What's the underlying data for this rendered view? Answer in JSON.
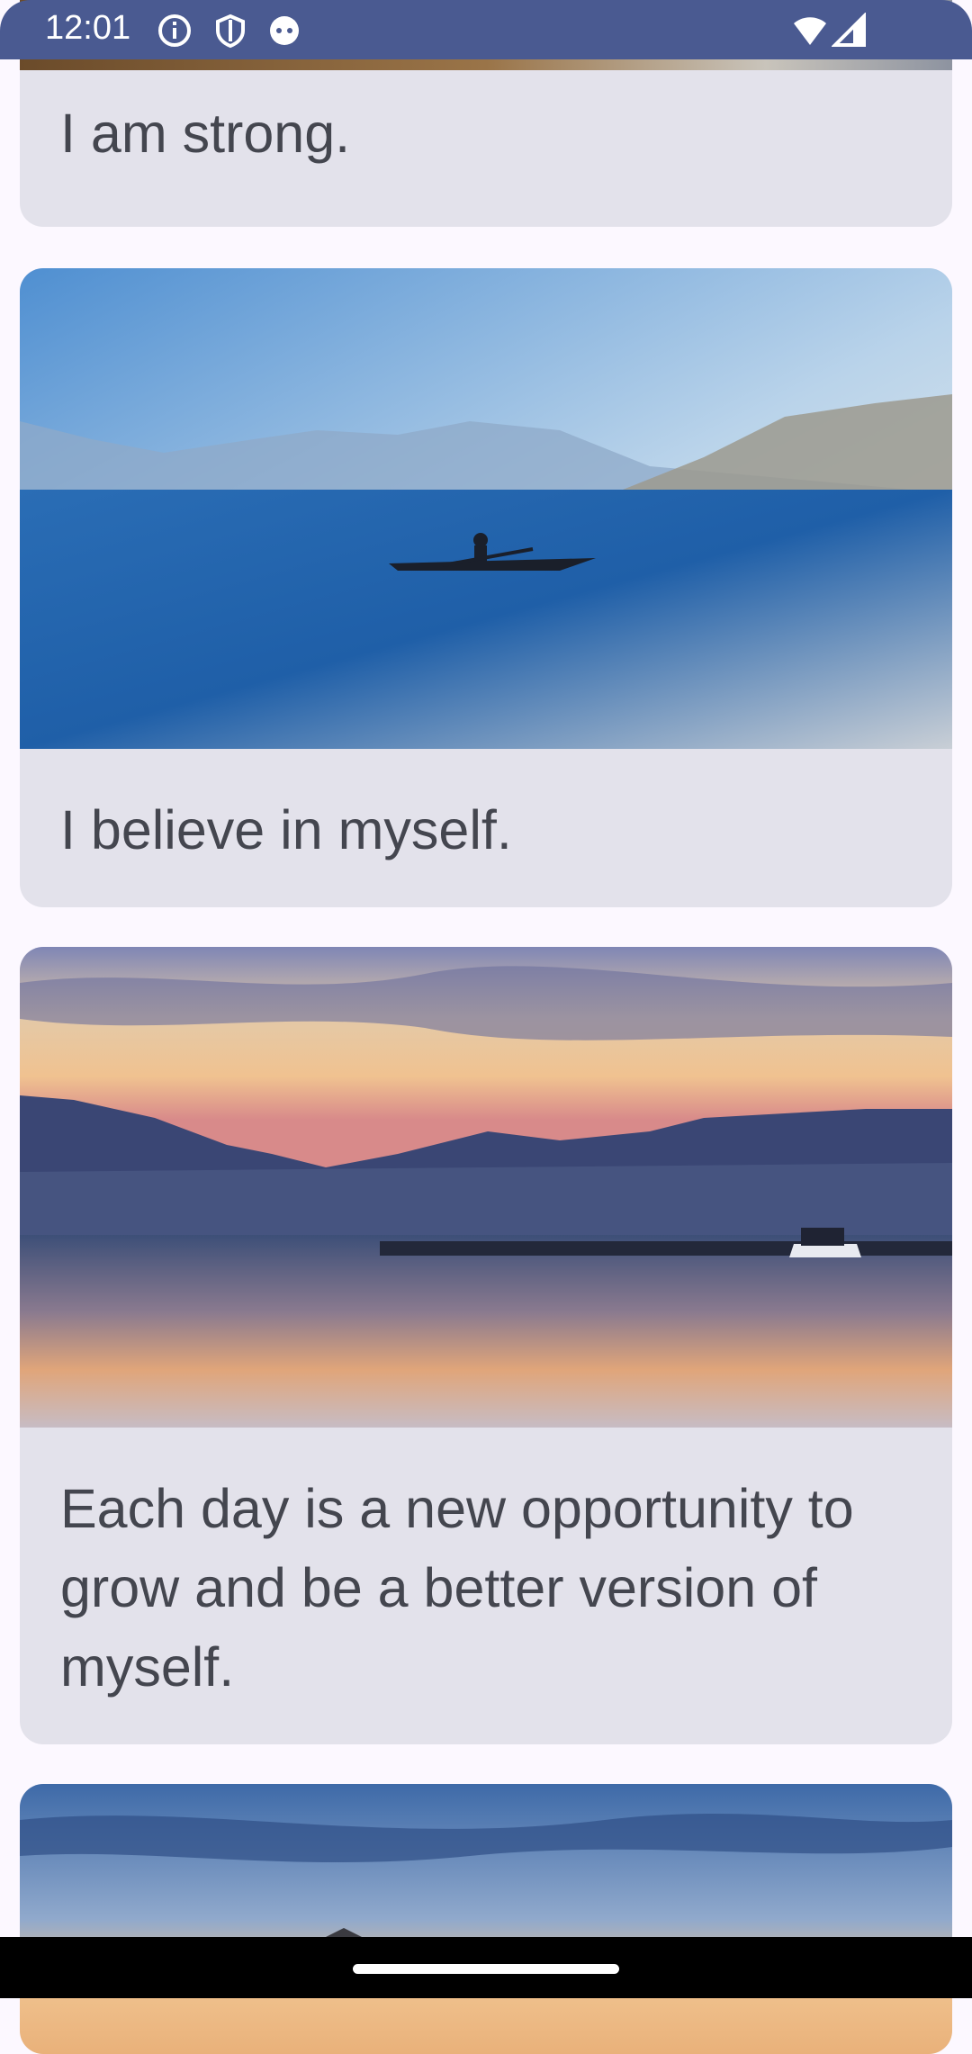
{
  "status_bar": {
    "time": "12:01",
    "icons": [
      "info-icon",
      "shield-icon",
      "android-face-icon",
      "wifi-icon",
      "signal-icon"
    ]
  },
  "cards": [
    {
      "caption": "I am strong.",
      "image": "photo-beach"
    },
    {
      "caption": "I believe in myself.",
      "image": "photo-lake-kayaker"
    },
    {
      "caption": "Each day is a new opportunity to grow and be a better version of myself.",
      "image": "photo-sunset-lake-boat"
    },
    {
      "caption": "",
      "image": "photo-sunset-clouds"
    }
  ],
  "colors": {
    "status_bar": "#4A5A91",
    "card_bg": "#E3E2EB",
    "page_bg": "#FCF8FF",
    "text": "#44464F"
  }
}
